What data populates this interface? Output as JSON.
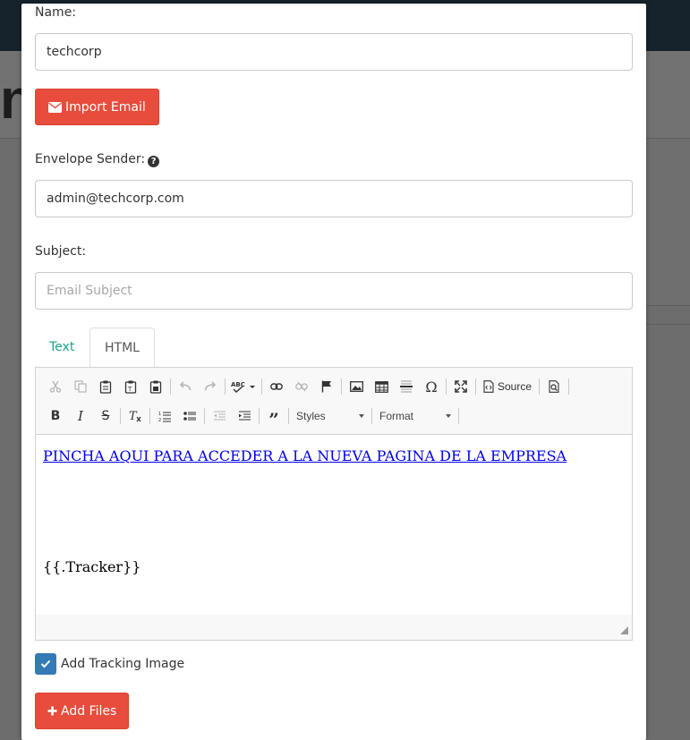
{
  "background": {
    "page_title_fragment": "n"
  },
  "form": {
    "name_label": "Name:",
    "name_value": "techcorp",
    "import_button": "Import Email",
    "envelope_sender_label": "Envelope Sender:",
    "envelope_sender_value": "admin@techcorp.com",
    "subject_label": "Subject:",
    "subject_placeholder": "Email Subject"
  },
  "tabs": [
    {
      "label": "Text",
      "active": false
    },
    {
      "label": "HTML",
      "active": true
    }
  ],
  "editor": {
    "toolbar": {
      "source_label": "Source",
      "styles_label": "Styles",
      "format_label": "Format"
    },
    "link_text": "PINCHA AQUI PARA ACCEDER A LA NUEVA PAGINA DE LA EMPRESA",
    "tracker_text": "{{.Tracker}}"
  },
  "tracking": {
    "label": "Add Tracking Image",
    "checked": true
  },
  "add_files_button": "Add Files",
  "colors": {
    "accent_red": "#e74c3c",
    "tab_active_text": "#18a689",
    "checkbox_blue": "#337ab7",
    "link_blue": "#0000ee"
  }
}
